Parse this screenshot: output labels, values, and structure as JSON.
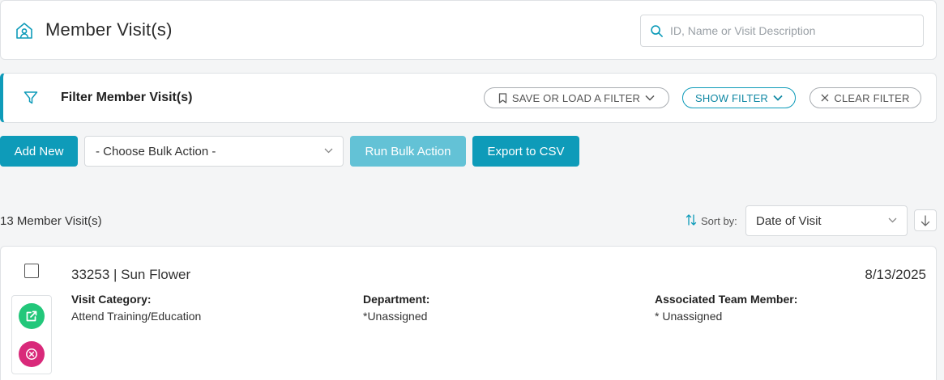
{
  "header": {
    "title": "Member Visit(s)",
    "search_placeholder": "ID, Name or Visit Description"
  },
  "filter": {
    "title": "Filter Member Visit(s)",
    "save_load_label": "SAVE OR LOAD A FILTER",
    "show_label": "SHOW FILTER",
    "clear_label": "CLEAR FILTER"
  },
  "actions": {
    "add_new_label": "Add New",
    "bulk_action_selected": "- Choose Bulk Action -",
    "run_bulk_label": "Run Bulk Action",
    "export_label": "Export to CSV"
  },
  "results": {
    "count_text": "13 Member Visit(s)",
    "sort_label": "Sort by:",
    "sort_selected": "Date of Visit"
  },
  "visits": [
    {
      "title": "33253 | Sun Flower",
      "date": "8/13/2025",
      "category_label": "Visit Category:",
      "category_value": "Attend Training/Education",
      "department_label": "Department:",
      "department_value": "*Unassigned",
      "team_member_label": "Associated Team Member:",
      "team_member_value": "* Unassigned"
    }
  ],
  "colors": {
    "accent": "#0e9bb9",
    "open_action": "#22c77a",
    "delete_action": "#d9297a"
  },
  "icons": [
    "home-person-icon",
    "search-icon",
    "filter-icon",
    "bookmark-icon",
    "chevron-down-icon",
    "close-icon",
    "sort-icon",
    "arrow-down-icon",
    "external-link-icon",
    "circle-x-icon"
  ]
}
